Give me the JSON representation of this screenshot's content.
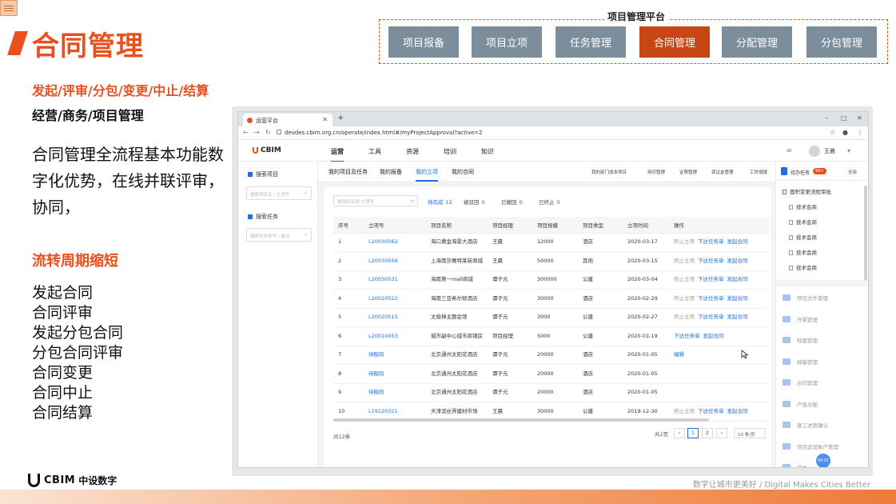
{
  "slide": {
    "title": "合同管理",
    "platform_label": "项目管理平台",
    "nav": [
      "项目报备",
      "项目立项",
      "任务管理",
      "合同管理",
      "分配管理",
      "分包管理"
    ],
    "subhead": "发起/评审/分包/变更/中止/结算",
    "subhead2": "经营/商务/项目管理",
    "description": "合同管理全流程基本功能数字化优势，在线并联评审，协同，",
    "section_title": "流转周期缩短",
    "steps": [
      "发起合同",
      "合同评审",
      "发起分包合同",
      "分包合同评审",
      "合同变更",
      "合同中止",
      "合同结算"
    ],
    "logo_text": "CBIM",
    "logo_cn": "中设数字",
    "slogan": "数字让城市更美好 / Digital Makes Cities Better",
    "accent": "#e8501e",
    "nav_active": "#c84514",
    "nav_color": "#7c8d9c"
  },
  "browser": {
    "tab_title": "运营平台",
    "url": "devdes.cbim.org.cn/operate/index.html#/myProjectApproval?active=2"
  },
  "app": {
    "logo": "CBIM",
    "menu": [
      "运营",
      "工具",
      "资源",
      "培训",
      "知识"
    ],
    "user": "王晨",
    "sidebar": {
      "search_project": "搜索项目",
      "search_project_ph": "搜索项目名 / 立项号",
      "search_task": "搜索任务",
      "search_task_ph": "搜索任务单号 / 备注"
    },
    "subtabs": [
      "我的项目及任务",
      "我的报备",
      "我的立项",
      "我的合同"
    ],
    "toollinks": [
      "我的部门成本项目",
      "用印管理",
      "证照管理",
      "保证金管理",
      "工时填报"
    ],
    "search_ph": "搜项目名称/立项号",
    "status_tabs": [
      {
        "label": "待完成",
        "count": "12"
      },
      {
        "label": "被驳回",
        "count": "0"
      },
      {
        "label": "已撤回",
        "count": "0"
      },
      {
        "label": "已终止",
        "count": "0"
      }
    ],
    "table": {
      "headers": [
        "序号",
        "立项号",
        "项目名称",
        "项目经理",
        "项目规模",
        "项目类型",
        "立项时间",
        "操作"
      ],
      "rows": [
        [
          "1",
          "L20030562",
          "海口黄金海景大酒店",
          "王晨",
          "12000",
          "酒店",
          "2020-03-17",
          "终止立项",
          "下达任务单",
          "发起合同"
        ],
        [
          "2",
          "L20030556",
          "上海南莎赛特莱新商城",
          "王晨",
          "50000",
          "其他",
          "2020-03-15",
          "终止立项",
          "下达任务单",
          "发起合同"
        ],
        [
          "3",
          "L20030531",
          "海南第一mall商城",
          "谭子元",
          "300000",
          "公建",
          "2020-03-04",
          "终止立项",
          "下达任务单",
          "发起合同"
        ],
        [
          "4",
          "L20020522",
          "海南三亚希尔顿酒店",
          "谭子元",
          "30000",
          "酒店",
          "2020-02-29",
          "终止立项",
          "下达任务单",
          "发起合同"
        ],
        [
          "5",
          "L20020515",
          "太极禅主题会馆",
          "谭子元",
          "3000",
          "公建",
          "2020-02-27",
          "终止立项",
          "下达任务单",
          "发起合同"
        ],
        [
          "6",
          "L20010453",
          "城市副中心城市商铺房",
          "项目经理",
          "5000",
          "公建",
          "2020-01-19",
          "",
          "下达任务单",
          "发起合同"
        ],
        [
          "7",
          "待赋码",
          "北京通州太阳花酒店",
          "谭子元",
          "20000",
          "酒店",
          "2020-01-05",
          "",
          "编辑",
          ""
        ],
        [
          "8",
          "待赋码",
          "北京通州太阳花酒店",
          "谭子元",
          "20000",
          "酒店",
          "2020-01-05",
          "",
          "",
          ""
        ],
        [
          "9",
          "待赋码",
          "北京通州太阳花酒店",
          "谭子元",
          "20000",
          "酒店",
          "2020-01-05",
          "",
          "",
          ""
        ],
        [
          "10",
          "L19120321",
          "天津滨丝界建材市场",
          "王晨",
          "30000",
          "公建",
          "2019-12-30",
          "终止立项",
          "下达任务单",
          "发起合同"
        ]
      ]
    },
    "total": "共12条",
    "pager": {
      "pages_label": "共2页",
      "page1": "1",
      "page2": "2",
      "size": "10 条/页"
    },
    "right_panel": {
      "title": "待办任务",
      "badge": "99+",
      "all": "全部",
      "items": [
        "面积变更流程审批",
        "技术会商",
        "技术会商",
        "技术会商",
        "技术会商",
        "技术会商"
      ],
      "modules": [
        "项目文件管理",
        "开票管理",
        "档案管理",
        "邮箱管理",
        "合同管理",
        "产值分配",
        "施工进度确认",
        "项目运营账户管理",
        "成本"
      ]
    },
    "float_btn": "00:01"
  }
}
